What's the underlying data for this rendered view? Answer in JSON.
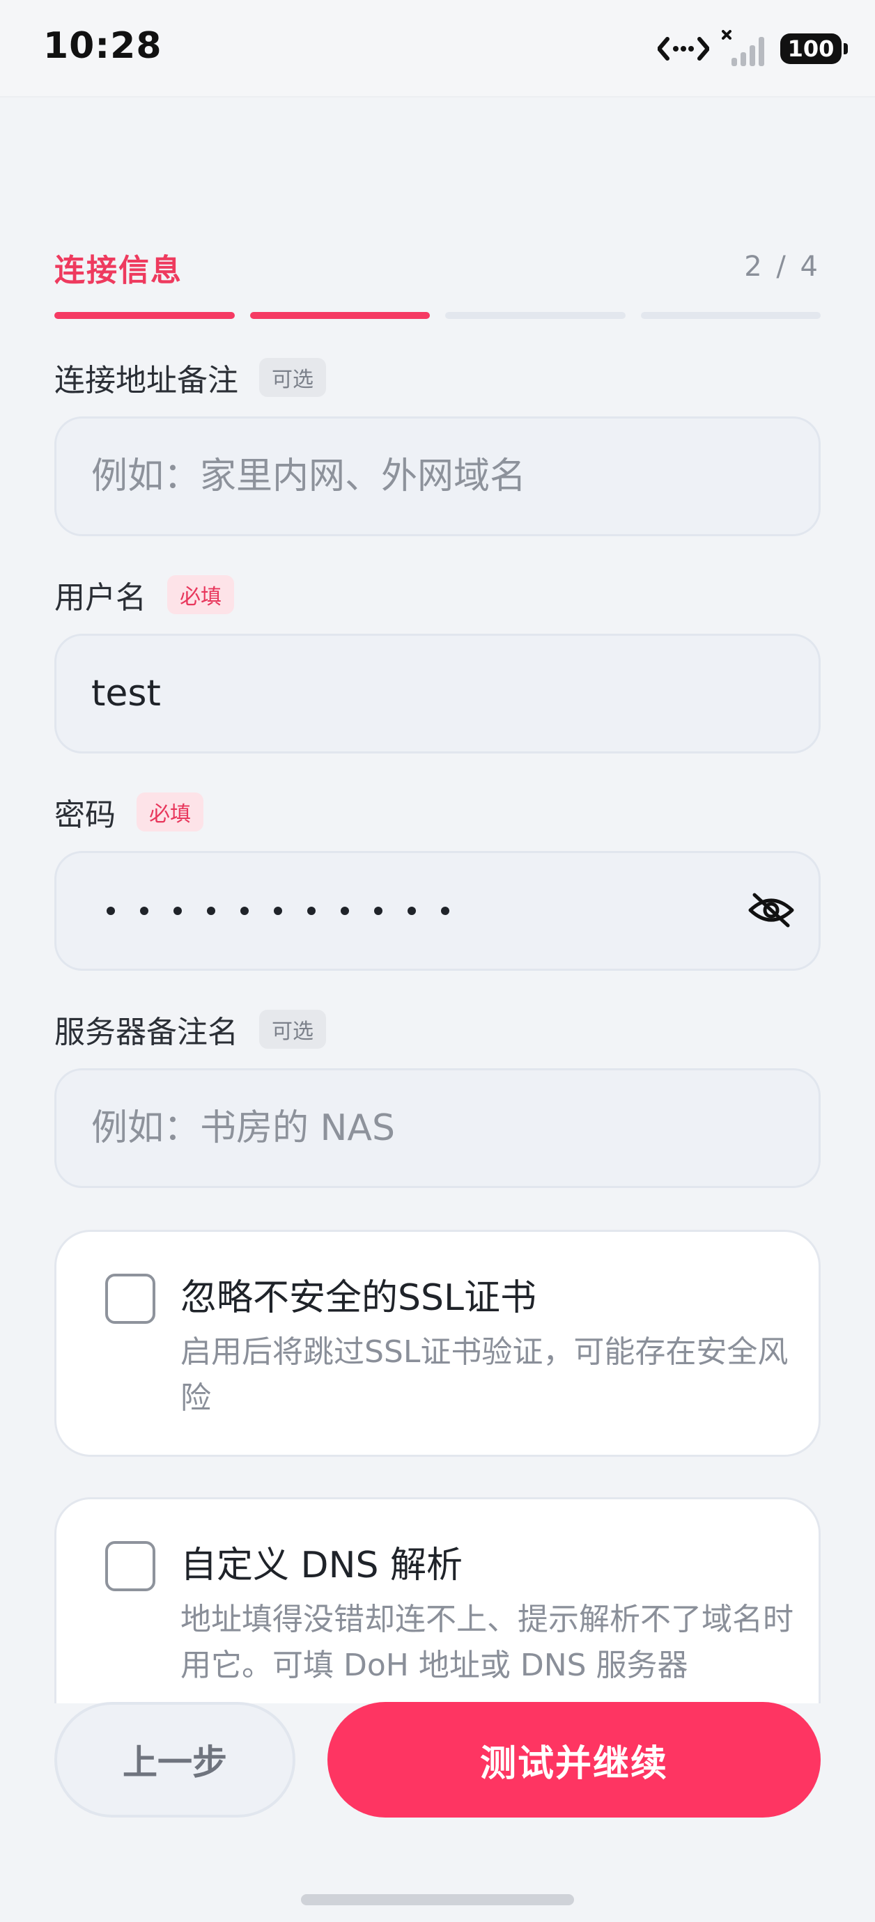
{
  "status_bar": {
    "time": "10:28",
    "battery": "100"
  },
  "step": {
    "title": "连接信息",
    "counter": "2 / 4",
    "current": 2,
    "total": 4
  },
  "fields": {
    "address_note": {
      "label": "连接地址备注",
      "tag": "可选",
      "placeholder": "例如：家里内网、外网域名"
    },
    "username": {
      "label": "用户名",
      "tag": "必填",
      "value": "test"
    },
    "password": {
      "label": "密码",
      "tag": "必填",
      "masked_length": 11
    },
    "server_note": {
      "label": "服务器备注名",
      "tag": "可选",
      "placeholder": "例如：书房的 NAS"
    }
  },
  "options": {
    "ignore_ssl": {
      "title": "忽略不安全的SSL证书",
      "description": "启用后将跳过SSL证书验证，可能存在安全风险",
      "checked": false
    },
    "custom_dns": {
      "title": "自定义 DNS 解析",
      "description": "地址填得没错却连不上、提示解析不了域名时用它。可填 DoH 地址或 DNS 服务器",
      "checked": false
    }
  },
  "buttons": {
    "prev": "上一步",
    "next": "测试并继续"
  }
}
